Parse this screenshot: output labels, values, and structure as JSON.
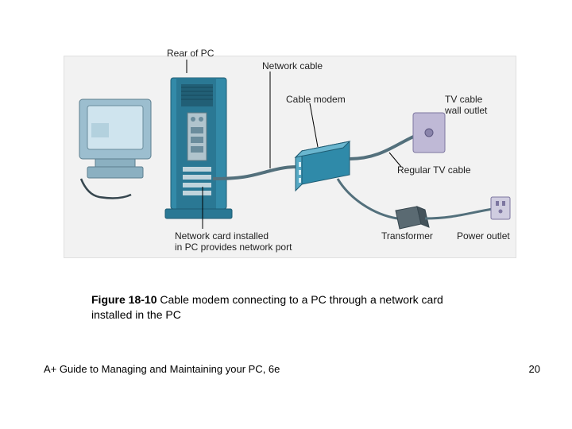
{
  "labels": {
    "rear_of_pc": "Rear of PC",
    "network_cable": "Network cable",
    "cable_modem": "Cable modem",
    "tv_cable_wall_outlet_l1": "TV cable",
    "tv_cable_wall_outlet_l2": "wall outlet",
    "regular_tv_cable": "Regular TV cable",
    "network_card_l1": "Network card installed",
    "network_card_l2": "in PC provides network port",
    "transformer": "Transformer",
    "power_outlet": "Power outlet"
  },
  "caption": {
    "figure_number": "Figure 18-10",
    "text": " Cable modem connecting to a PC through a network card installed in the PC"
  },
  "footer": {
    "book": "A+ Guide to Managing and Maintaining your PC, 6e",
    "page": "20"
  }
}
